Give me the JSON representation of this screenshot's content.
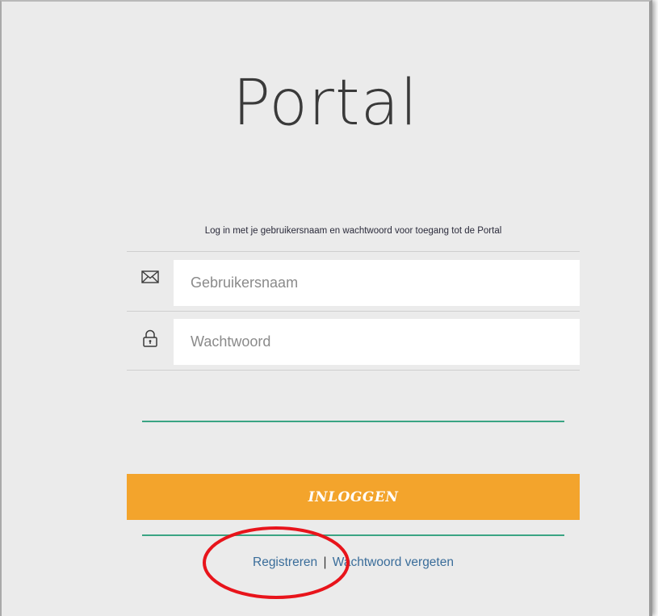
{
  "page": {
    "title": "Portal",
    "intro": "Log in met je gebruikersnaam en wachtwoord voor toegang tot de Portal"
  },
  "form": {
    "username": {
      "placeholder": "Gebruikersnaam",
      "value": "",
      "icon": "envelope-icon"
    },
    "password": {
      "placeholder": "Wachtwoord",
      "value": "",
      "icon": "lock-icon"
    },
    "submit_label": "INLOGGEN"
  },
  "links": {
    "register": "Registreren",
    "separator": "|",
    "forgot_password": "Wachtwoord vergeten"
  },
  "colors": {
    "background": "#ebebeb",
    "button": "#f3a42c",
    "divider_green": "#3aa483",
    "link": "#3a6d9a",
    "annotation": "#e8141b"
  }
}
